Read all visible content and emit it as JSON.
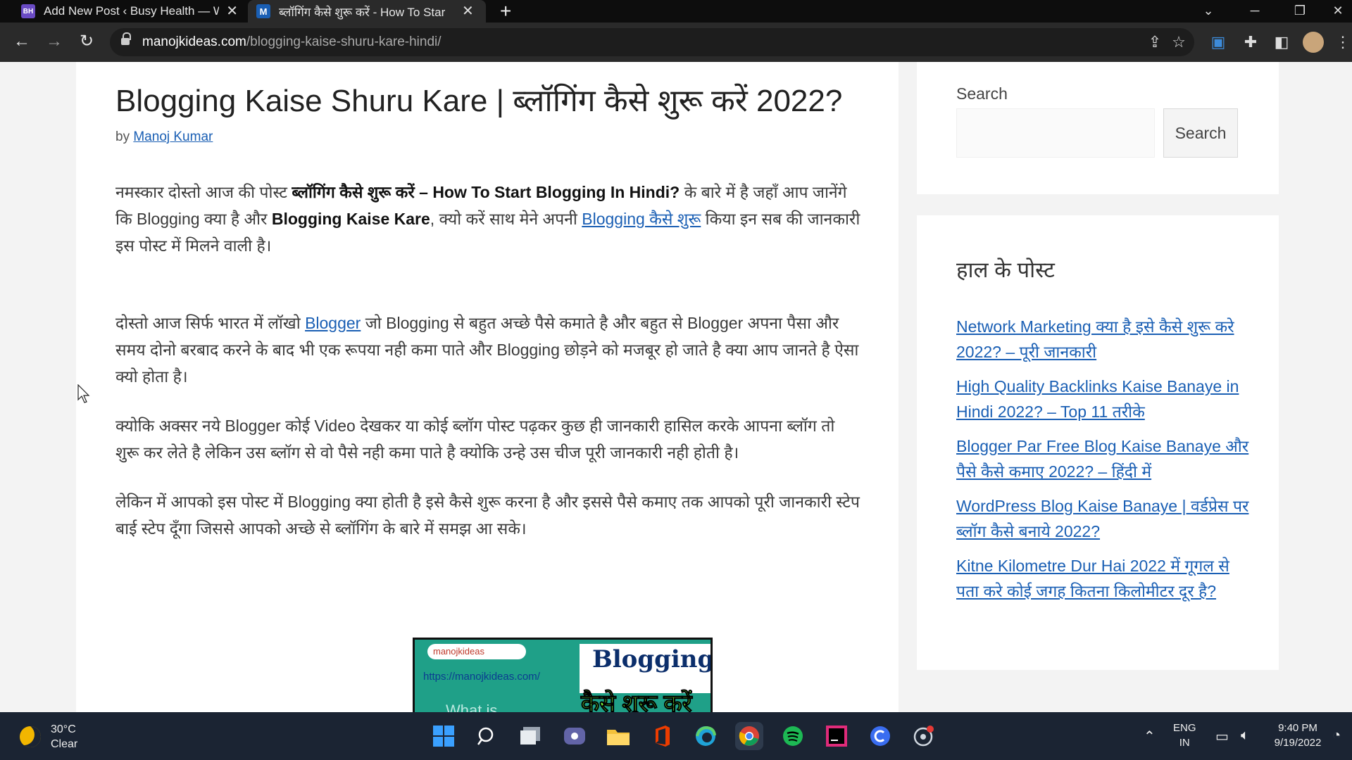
{
  "tabs": [
    {
      "favicon": "BH",
      "title": "Add New Post ‹ Busy Health — W",
      "close": "✕"
    },
    {
      "favicon": "M",
      "title": "ब्लॉगिंग कैसे शुरू करें - How To Star",
      "close": "✕"
    }
  ],
  "new_tab": "+",
  "address": {
    "domain": "manojkideas.com",
    "path": "/blogging-kaise-shuru-kare-hindi/"
  },
  "post": {
    "title": "Blogging Kaise Shuru Kare | ब्लॉगिंग कैसे शुरू करें 2022?",
    "by": "by",
    "author": "Manoj Kumar",
    "p1": {
      "t1": "नमस्कार दोस्तो आज की पोस्ट ",
      "b1": "ब्लॉगिंग कैसे शुरू करें – How To Start Blogging In Hindi?",
      "t2": " के बारे में है जहाँ आप जानेंगे कि Blogging क्या है और ",
      "b2": "Blogging Kaise Kare",
      "t3": ", क्यो करें साथ मेने अपनी ",
      "link": "Blogging कैसे शुरू",
      "t4": " किया इन सब की जानकारी इस पोस्ट में मिलने वाली है।"
    },
    "p2": {
      "t1": "दोस्तो आज सिर्फ भारत में लॉखो ",
      "link": "Blogger",
      "t2": " जो Blogging से बहुत अच्छे पैसे कमाते है और बहुत से Blogger अपना पैसा और समय दोनो बरबाद करने के बाद भी एक रूपया नही कमा पाते और Blogging छोड़ने को मजबूर हो जाते है क्या आप जानते है ऐसा क्यो होता है।"
    },
    "p3": "क्योकि अक्सर नये Blogger कोई Video देखकर या कोई ब्लॉग पोस्ट पढ़कर कुछ ही जानकारी हासिल करके आपना ब्लॉग तो शुरू कर लेते है लेकिन उस ब्लॉग से वो पैसे नही कमा पाते है क्योकि उन्हे उस चीज पूरी जानकारी नही होती है।",
    "p4": "लेकिन में आपको इस पोस्ट में Blogging क्या होती है इसे कैसे शुरू करना है और इससे पैसे कमाए तक आपको पूरी जानकारी स्टेप बाई स्टेप दूँगा जिससे आपको अच्छे से ब्लॉगिंग के बारे में समझ आ सके।",
    "thumbnail": {
      "brand": "manojkideas",
      "url": "https://manojkideas.com/",
      "heading": "Blogging",
      "hindi": "कैसे शुरू करें",
      "sub": "What is"
    }
  },
  "sidebar": {
    "search_label": "Search",
    "search_button": "Search",
    "recent_heading": "हाल के पोस्ट",
    "recent": [
      "Network Marketing क्या है इसे कैसे शुरू करे 2022? – पूरी जानकारी",
      "High Quality Backlinks Kaise Banaye in Hindi 2022? – Top 11 तरीके",
      "Blogger Par Free Blog Kaise Banaye और पैसे कैसे कमाए 2022? – हिंदी में",
      "WordPress Blog Kaise Banaye | वर्डप्रेस पर ब्लॉग कैसे बनाये 2022?",
      "Kitne Kilometre Dur Hai 2022 में गूगल से पता करे कोई जगह कितना किलोमीटर दूर है?"
    ]
  },
  "taskbar": {
    "temp": "30°C",
    "condition": "Clear",
    "lang1": "ENG",
    "lang2": "IN",
    "time": "9:40 PM",
    "date": "9/19/2022"
  },
  "colors": {
    "link": "#1a5fb4",
    "taskbar": "#1b2433",
    "thumb": "#1fa088"
  }
}
